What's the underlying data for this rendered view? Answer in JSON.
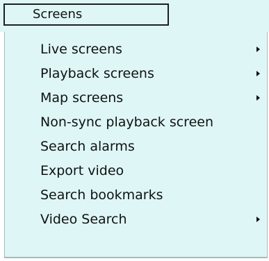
{
  "menu": {
    "title": "Screens",
    "items": [
      {
        "label": "Live screens",
        "submenu": true
      },
      {
        "label": "Playback screens",
        "submenu": true
      },
      {
        "label": "Map screens",
        "submenu": true
      },
      {
        "label": "Non-sync playback screen",
        "submenu": false
      },
      {
        "label": "Search alarms",
        "submenu": false
      },
      {
        "label": "Export video",
        "submenu": false
      },
      {
        "label": "Search bookmarks",
        "submenu": false
      },
      {
        "label": "Video Search",
        "submenu": true
      }
    ]
  },
  "colors": {
    "menu_background": "#def6f6",
    "text": "#111111",
    "title_border": "#1e1e1e"
  },
  "icons": {
    "submenu_arrow": "arrow-right-icon"
  }
}
